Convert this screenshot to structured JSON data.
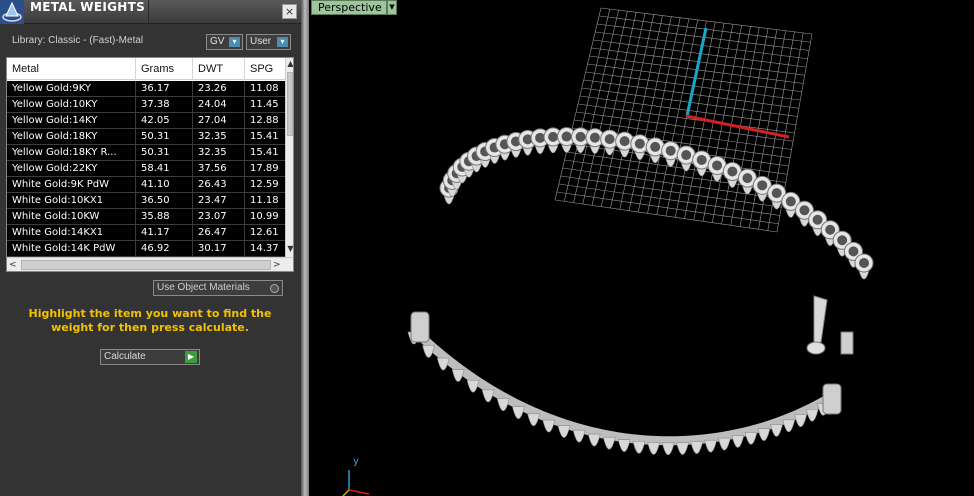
{
  "panel": {
    "title": "METAL WEIGHTS",
    "close_label": "×",
    "library_label": "Library: Classic - (Fast)-Metal",
    "gv_label": "GV",
    "user_label": "User",
    "dropdown_button": "▾",
    "use_object_materials": "Use Object Materials",
    "instruction": "Highlight the item you want to find the weight for then press calculate.",
    "calculate_label": "Calculate",
    "calculate_icon": "play-icon"
  },
  "table": {
    "headers": [
      "Metal",
      "Grams",
      "DWT",
      "SPG"
    ],
    "rows": [
      [
        "Yellow Gold:9KY",
        "36.17",
        "23.26",
        "11.08"
      ],
      [
        "Yellow Gold:10KY",
        "37.38",
        "24.04",
        "11.45"
      ],
      [
        "Yellow Gold:14KY",
        "42.05",
        "27.04",
        "12.88"
      ],
      [
        "Yellow Gold:18KY",
        "50.31",
        "32.35",
        "15.41"
      ],
      [
        "Yellow Gold:18KY R...",
        "50.31",
        "32.35",
        "15.41"
      ],
      [
        "Yellow Gold:22KY",
        "58.41",
        "37.56",
        "17.89"
      ],
      [
        "White Gold:9K PdW",
        "41.10",
        "26.43",
        "12.59"
      ],
      [
        "White Gold:10KX1",
        "36.50",
        "23.47",
        "11.18"
      ],
      [
        "White Gold:10KW",
        "35.88",
        "23.07",
        "10.99"
      ],
      [
        "White Gold:14KX1",
        "41.17",
        "26.47",
        "12.61"
      ],
      [
        "White Gold:14K PdW",
        "46.92",
        "30.17",
        "14.37"
      ]
    ]
  },
  "viewport": {
    "view_name": "Perspective",
    "axis_y": "y",
    "colors": {
      "grid": "#9a9a9a",
      "axis_y": "#1aa7c4",
      "axis_x": "#d42020",
      "model": "#d8d8d8"
    }
  }
}
